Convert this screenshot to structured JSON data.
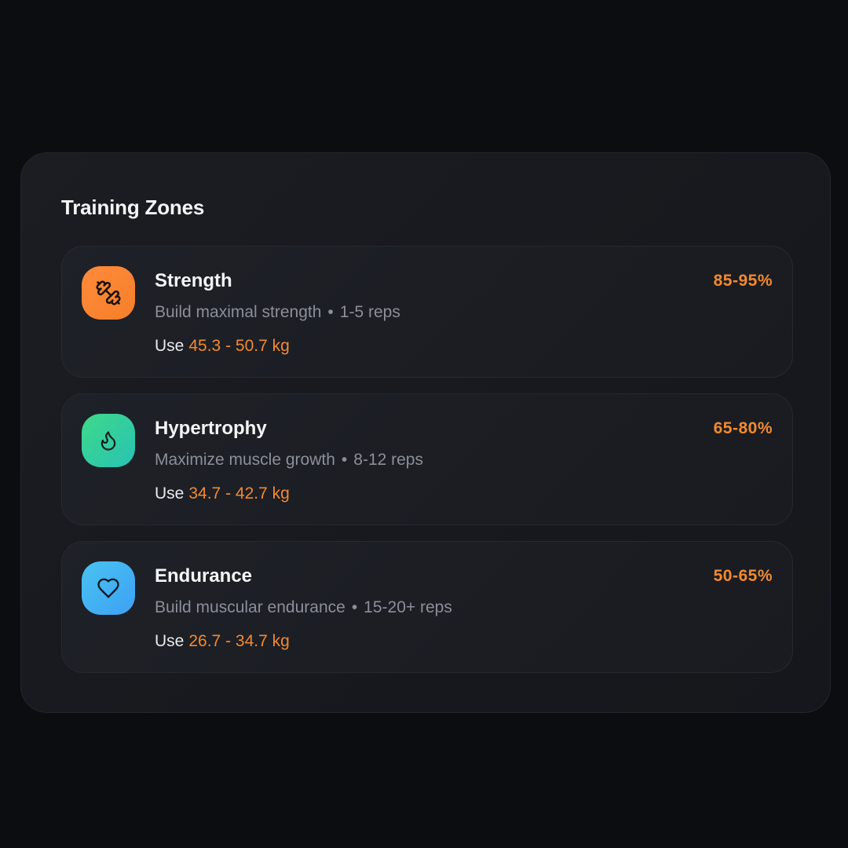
{
  "title": "Training Zones",
  "zones": [
    {
      "name": "Strength",
      "description": "Build maximal strength",
      "reps": "1-5 reps",
      "use_label": "Use",
      "range": "45.3 - 50.7 kg",
      "percent": "85-95%",
      "icon": "dumbbell-icon",
      "icon_colors": [
        "#ff8a3a",
        "#f57f2a"
      ]
    },
    {
      "name": "Hypertrophy",
      "description": "Maximize muscle growth",
      "reps": "8-12 reps",
      "use_label": "Use",
      "range": "34.7 - 42.7 kg",
      "percent": "65-80%",
      "icon": "flame-icon",
      "icon_colors": [
        "#3fd98a",
        "#28c2b4"
      ]
    },
    {
      "name": "Endurance",
      "description": "Build muscular endurance",
      "reps": "15-20+ reps",
      "use_label": "Use",
      "range": "26.7 - 34.7 kg",
      "percent": "50-65%",
      "icon": "heart-icon",
      "icon_colors": [
        "#48c4f0",
        "#3ea0f5"
      ]
    }
  ],
  "separator": "•",
  "accent_color": "#f28a2e"
}
